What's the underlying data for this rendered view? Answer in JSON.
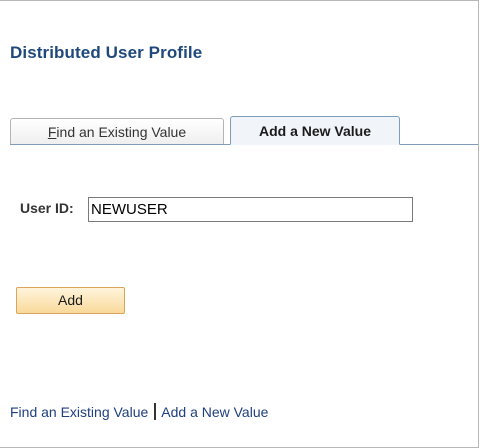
{
  "page": {
    "title": "Distributed User Profile"
  },
  "tabs": [
    {
      "label_access_key": "F",
      "label_rest": "ind an Existing Value",
      "label": "Find an Existing Value",
      "selected": false
    },
    {
      "label": "Add a New Value",
      "selected": true
    }
  ],
  "form": {
    "user_id_label": "User ID:",
    "user_id_value": "NEWUSER",
    "add_button_label": "Add"
  },
  "footer": {
    "links": [
      {
        "label": "Find an Existing Value"
      },
      {
        "label": "Add a New Value"
      }
    ]
  },
  "colors": {
    "title": "#1f497d",
    "link": "#1f3f7f",
    "button_bg": "#f9d99a",
    "button_border": "#d9a55a",
    "active_tab_bg": "#f1f5fa"
  }
}
